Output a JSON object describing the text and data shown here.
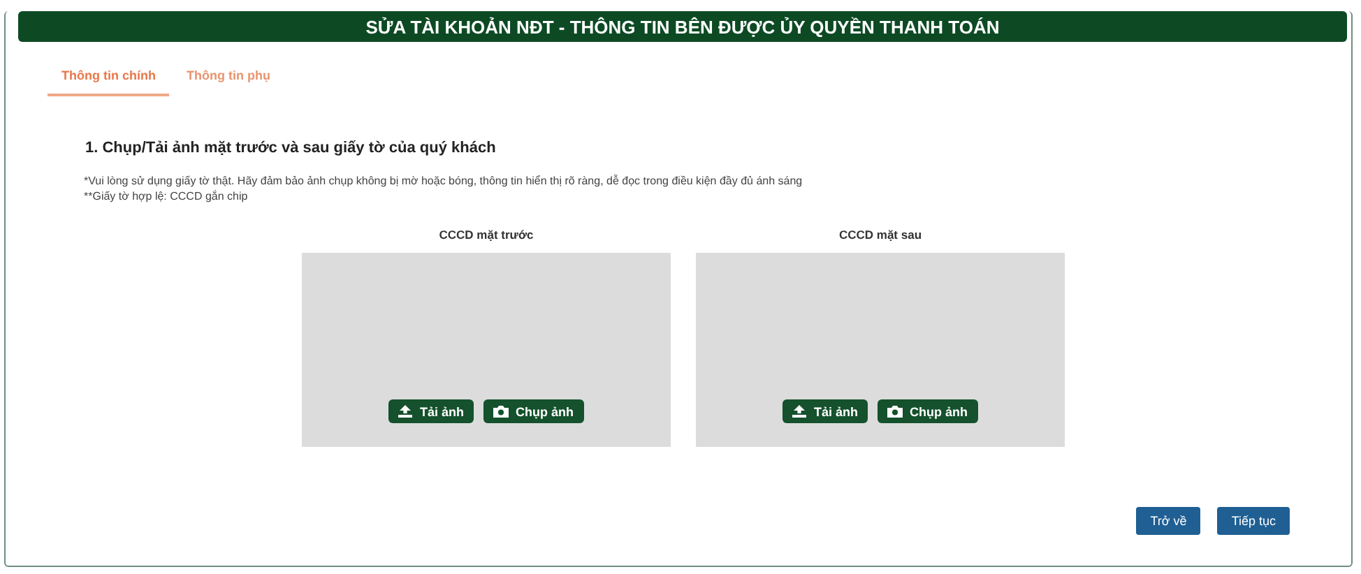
{
  "header": {
    "title": "SỬA TÀI KHOẢN NĐT - THÔNG TIN BÊN ĐƯỢC ỦY QUYỀN THANH TOÁN"
  },
  "tabs": [
    {
      "label": "Thông tin chính",
      "selected": true
    },
    {
      "label": "Thông tin phụ",
      "selected": false
    }
  ],
  "section": {
    "heading": "1. Chụp/Tải ảnh mặt trước và sau giấy tờ của quý khách",
    "notes": [
      "*Vui lòng sử dụng giấy tờ thật. Hãy đảm bảo ảnh chụp không bị mờ hoặc bóng, thông tin hiển thị rõ ràng, dễ đọc trong điều kiện đầy đủ ánh sáng",
      "**Giấy tờ hợp lệ: CCCD gắn chip"
    ]
  },
  "cards": [
    {
      "label": "CCCD mặt trước",
      "upload": "Tải ảnh",
      "capture": "Chụp ảnh"
    },
    {
      "label": "CCCD mặt sau",
      "upload": "Tải ảnh",
      "capture": "Chụp ảnh"
    }
  ],
  "footer": {
    "buttons": [
      "Trở về",
      "Tiếp tục"
    ]
  }
}
